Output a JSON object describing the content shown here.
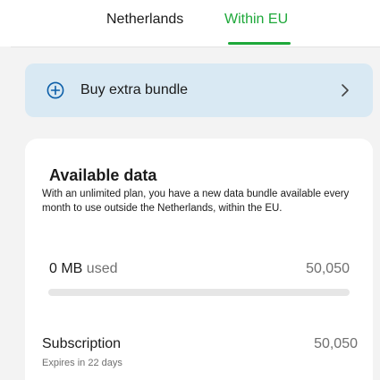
{
  "tabs": [
    {
      "label": "Netherlands",
      "active": false
    },
    {
      "label": "Within EU",
      "active": true
    }
  ],
  "colors": {
    "accent": "#1ea83a",
    "banner_bg": "#d9e9f3",
    "icon_blue": "#0b5ea8"
  },
  "buy_bundle": {
    "label": "Buy extra bundle",
    "leading_icon": "plus-circle-icon",
    "trailing_icon": "chevron-right-icon"
  },
  "available_data": {
    "title": "Available data",
    "description": "With an unlimited plan, you have a new data bundle available every month to use outside the Netherlands, within the EU.",
    "used_value": "0 MB",
    "used_label": "used",
    "total": "50,050",
    "used_fraction": 0
  },
  "subscription": {
    "title": "Subscription",
    "expires": "Expires in 22 days",
    "value": "50,050"
  }
}
